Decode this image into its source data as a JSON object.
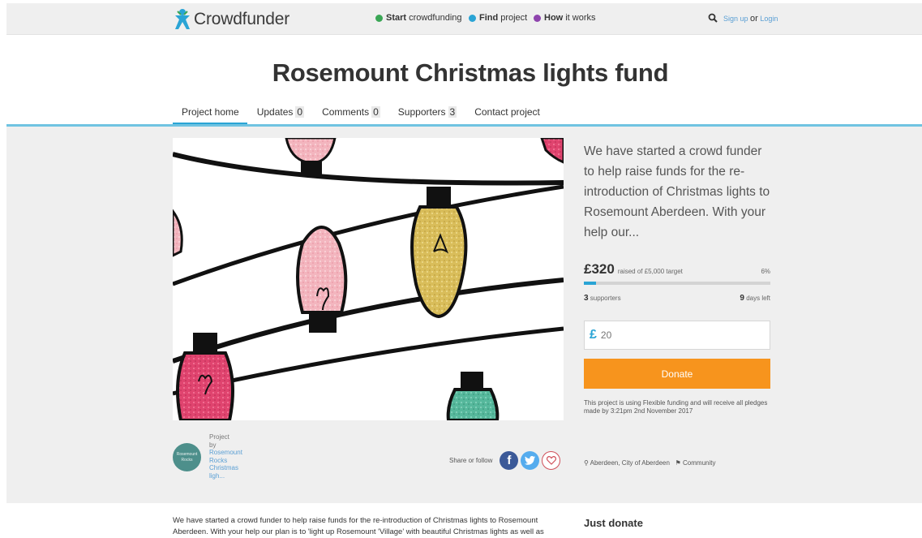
{
  "header": {
    "logo_text": "Crowdfunder",
    "nav": [
      {
        "bold": "Start",
        "rest": " crowdfunding",
        "icon": "plus-circle-icon",
        "color": "#3aa655"
      },
      {
        "bold": "Find",
        "rest": " project",
        "icon": "globe-icon",
        "color": "#2aa4d5"
      },
      {
        "bold": "How",
        "rest": " it works",
        "icon": "question-circle-icon",
        "color": "#8e44ad"
      }
    ],
    "signup": "Sign up",
    "or": "or",
    "login": "Login"
  },
  "project": {
    "title": "Rosemount Christmas lights fund"
  },
  "tabs": [
    {
      "label": "Project home",
      "count": ""
    },
    {
      "label": "Updates",
      "count": "0"
    },
    {
      "label": "Comments",
      "count": "0"
    },
    {
      "label": "Supporters",
      "count": "3"
    },
    {
      "label": "Contact project",
      "count": ""
    }
  ],
  "summary": "We have started a crowd funder to help raise funds for the re-introduction of Christmas lights to Rosemount Aberdeen. With your help our...",
  "funding": {
    "amount": "£320",
    "raised_text": "raised of £5,000 target",
    "percent": "6%",
    "progress_fraction": 0.064,
    "supporters_count": "3",
    "supporters_label": "supporters",
    "days_count": "9",
    "days_label": "days left",
    "currency": "£",
    "amount_placeholder": "20",
    "donate_label": "Donate",
    "note": "This project is using Flexible funding and will receive all pledges made by 3:21pm 2nd November 2017"
  },
  "owner": {
    "project_label": "Project",
    "by_label": "by",
    "name_lines": [
      "Rosemount",
      "Rocks",
      "Christmas",
      "ligh..."
    ],
    "avatar_text": "Rosemount Rocks"
  },
  "share": {
    "label": "Share or follow"
  },
  "tags": {
    "location": "Aberdeen, City of Aberdeen",
    "category": "Community"
  },
  "story_text": "We have started a crowd funder to help raise funds for the re-introduction of Christmas lights to Rosemount Aberdeen. With your help our plan is to 'light up Rosemount 'Village' with beautiful Christmas lights as well as",
  "sidebar": {
    "just_donate": "Just donate"
  },
  "colors": {
    "accent": "#2aa4d5",
    "donate": "#f7941d",
    "facebook": "#3b5998",
    "twitter": "#55acee",
    "heart": "#d0505a"
  }
}
